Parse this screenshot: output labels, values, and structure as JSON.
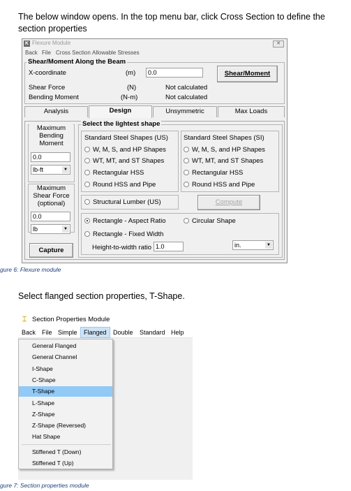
{
  "intro_text": "The below window opens. In the top menu bar, click Cross Section to define the section properties",
  "figure6_caption": "gure 6: Flexure module",
  "flexure": {
    "window_title": "Flexure Module",
    "icon_glyph": "K",
    "close_glyph": "✕",
    "menu": [
      "Back",
      "File",
      "Cross Section",
      "Allowable Stresses"
    ],
    "beam_group_title": "Shear/Moment Along the Beam",
    "x_label": "X-coordinate",
    "x_unit": "(m)",
    "x_value": "0.0",
    "shear_moment_button": "Shear/Moment",
    "shear_force_label": "Shear Force",
    "shear_force_unit": "(N)",
    "shear_force_value": "Not calculated",
    "bending_moment_label": "Bending Moment",
    "bending_moment_unit": "(N-m)",
    "bending_moment_value": "Not calculated",
    "tabs": [
      "Analysis",
      "Design",
      "Unsymmetric",
      "Max Loads"
    ],
    "active_tab": "Design",
    "max_moment_label": "Maximum Bending Moment",
    "max_moment_value": "0.0",
    "max_moment_unit": "lb-ft",
    "max_shear_label": "Maximum Shear Force (optional)",
    "max_shear_value": "0.0",
    "max_shear_unit": "lb",
    "capture_button": "Capture",
    "lightest_title": "Select the lightest shape",
    "us_title": "Standard Steel Shapes (US)",
    "us_options": [
      "W, M, S, and HP Shapes",
      "WT, MT, and ST Shapes",
      "Rectangular HSS",
      "Round HSS and Pipe"
    ],
    "si_title": "Standard Steel Shapes (SI)",
    "si_options": [
      "W, M, S, and HP Shapes",
      "WT, MT, and ST Shapes",
      "Rectangular HSS",
      "Round HSS and Pipe"
    ],
    "lumber_option": "Structural Lumber (US)",
    "compute_button": "Compute",
    "rect_aspect_option": "Rectangle - Aspect Ratio",
    "rect_fixed_option": "Rectangle - Fixed Width",
    "circular_option": "Circular Shape",
    "ratio_label": "Height-to-width ratio",
    "ratio_value": "1.0",
    "length_unit": "in.",
    "selected_option": "Rectangle - Aspect Ratio"
  },
  "flanged_intro": "Select flanged section properties, T-Shape.",
  "section": {
    "window_title": "Section Properties Module",
    "icon_glyph": "⌶",
    "menu": [
      "Back",
      "File",
      "Simple",
      "Flanged",
      "Double",
      "Standard",
      "Help"
    ],
    "active_menu": "Flanged",
    "dropdown_items": [
      "General Flanged",
      "General Channel",
      "I-Shape",
      "C-Shape",
      "T-Shape",
      "L-Shape",
      "Z-Shape",
      "Z-Shape (Reversed)",
      "Hat Shape",
      "Stiffened T (Down)",
      "Stiffened T (Up)"
    ],
    "highlighted_item": "T-Shape"
  },
  "figure7_caption": "gure 7: Section properties module",
  "colors": {
    "caption": "#1f3f7a",
    "menu_highlight": "#cce4f7",
    "item_highlight": "#91c9f7"
  }
}
